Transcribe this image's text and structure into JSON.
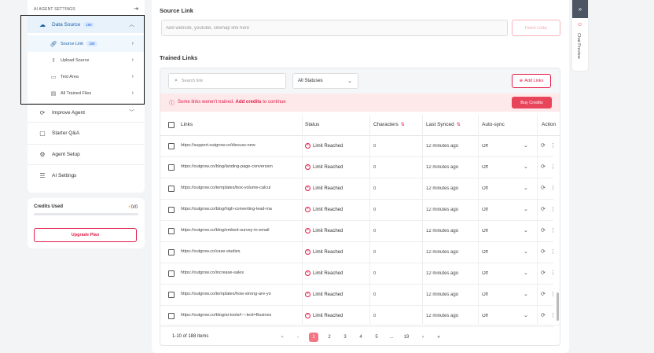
{
  "sidebar": {
    "header": "AI AGENT SETTINGS",
    "data_source": {
      "label": "Data Source",
      "badge": "188"
    },
    "sub_items": [
      {
        "label": "Source Link",
        "badge": "188"
      },
      {
        "label": "Upload Source"
      },
      {
        "label": "Text Area"
      },
      {
        "label": "All Trained Files"
      }
    ],
    "items": [
      {
        "label": "Improve Agent"
      },
      {
        "label": "Starter Q&A"
      },
      {
        "label": "Agent Setup"
      },
      {
        "label": "AI Settings"
      }
    ]
  },
  "credits": {
    "title": "Credits Used",
    "count": "0/0",
    "upgrade_label": "Upgrade Plan",
    "progress": 0
  },
  "source_link": {
    "title": "Source Link",
    "placeholder": "Add website, youtube, sitemap link here",
    "fetch_label": "Fetch Links"
  },
  "trained_links": {
    "title": "Trained Links",
    "search_placeholder": "Search link",
    "status_filter": "All Statuses",
    "add_links_label": "Add Links",
    "alert": {
      "message": "Some links weren't trained.",
      "action": "Add credits",
      "suffix": "to continue",
      "buy_label": "Buy Credits"
    },
    "columns": [
      "Links",
      "Status",
      "Characters",
      "Last Synced",
      "Auto-sync",
      "Action"
    ],
    "rows": [
      {
        "link": "https://support.outgrow.co/discuss-new",
        "status": "Limit Reached",
        "characters": "0",
        "last_synced": "12 minutes ago",
        "auto_sync": "Off"
      },
      {
        "link": "https://outgrow.co/blog/landing-page-conversion",
        "status": "Limit Reached",
        "characters": "0",
        "last_synced": "12 minutes ago",
        "auto_sync": "Off"
      },
      {
        "link": "https://outgrow.co/templates/box-volume-calcul",
        "status": "Limit Reached",
        "characters": "0",
        "last_synced": "12 minutes ago",
        "auto_sync": "Off"
      },
      {
        "link": "https://outgrow.co/blog/high-converting-lead-ma",
        "status": "Limit Reached",
        "characters": "0",
        "last_synced": "12 minutes ago",
        "auto_sync": "Off"
      },
      {
        "link": "https://outgrow.co/blog/embed-survey-in-email",
        "status": "Limit Reached",
        "characters": "0",
        "last_synced": "12 minutes ago",
        "auto_sync": "Off"
      },
      {
        "link": "https://outgrow.co/case-studies",
        "status": "Limit Reached",
        "characters": "0",
        "last_synced": "12 minutes ago",
        "auto_sync": "Off"
      },
      {
        "link": "https://outgrow.co/increase-sales",
        "status": "Limit Reached",
        "characters": "0",
        "last_synced": "12 minutes ago",
        "auto_sync": "Off"
      },
      {
        "link": "https://outgrow.co/templates/how-strong-are-yo",
        "status": "Limit Reached",
        "characters": "0",
        "last_synced": "12 minutes ago",
        "auto_sync": "Off"
      },
      {
        "link": "https://outgrow.co/blog/ai-tools#:~:text=Busines",
        "status": "Limit Reached",
        "characters": "0",
        "last_synced": "12 minutes ago",
        "auto_sync": "Off"
      }
    ],
    "pagination": {
      "info": "1-10 of 188 items",
      "pages": [
        "1",
        "2",
        "3",
        "4",
        "5",
        "...",
        "19"
      ],
      "current": "1"
    }
  },
  "chat_preview": {
    "label": "Chat Preview"
  }
}
